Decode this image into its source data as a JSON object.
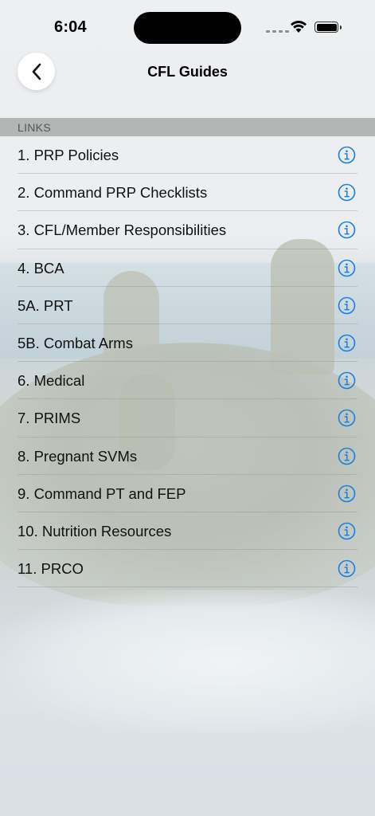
{
  "status_bar": {
    "time": "6:04"
  },
  "nav": {
    "title": "CFL Guides",
    "back_icon": "chevron-left-icon"
  },
  "section": {
    "header": "LINKS"
  },
  "accent_color": "#1a7fe0",
  "items": [
    {
      "label": "1. PRP Policies"
    },
    {
      "label": "2. Command PRP Checklists"
    },
    {
      "label": "3. CFL/Member Responsibilities"
    },
    {
      "label": "4. BCA"
    },
    {
      "label": "5A. PRT"
    },
    {
      "label": "5B. Combat Arms"
    },
    {
      "label": "6. Medical"
    },
    {
      "label": "7. PRIMS"
    },
    {
      "label": "8. Pregnant SVMs"
    },
    {
      "label": "9. Command PT and FEP"
    },
    {
      "label": "10. Nutrition Resources"
    },
    {
      "label": "11. PRCO"
    }
  ]
}
